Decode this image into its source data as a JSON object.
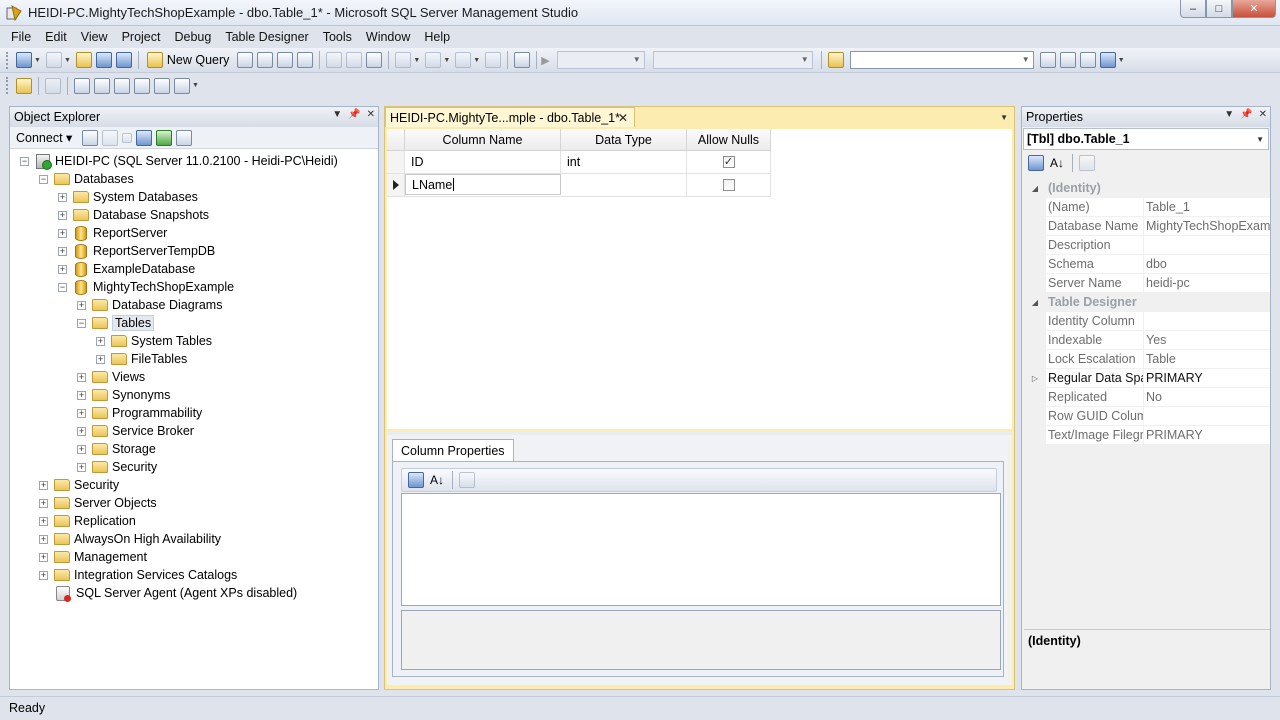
{
  "window": {
    "title": "HEIDI-PC.MightyTechShopExample - dbo.Table_1* - Microsoft SQL Server Management Studio",
    "minimize": "–",
    "maximize": "□",
    "close": "✕"
  },
  "menu": [
    "File",
    "Edit",
    "View",
    "Project",
    "Debug",
    "Table Designer",
    "Tools",
    "Window",
    "Help"
  ],
  "toolbar": {
    "new_query_label": "New Query"
  },
  "object_explorer": {
    "title": "Object Explorer",
    "connect_label": "Connect ▾",
    "tree": [
      {
        "label": "HEIDI-PC (SQL Server 11.0.2100 - Heidi-PC\\Heidi)",
        "icon": "server-icon",
        "level": 0,
        "exp": "−"
      },
      {
        "label": "Databases",
        "icon": "folder-icon",
        "level": 1,
        "exp": "−"
      },
      {
        "label": "System Databases",
        "icon": "folder-icon",
        "level": 2,
        "exp": "+"
      },
      {
        "label": "Database Snapshots",
        "icon": "folder-icon",
        "level": 2,
        "exp": "+"
      },
      {
        "label": "ReportServer",
        "icon": "database-icon",
        "level": 2,
        "exp": "+"
      },
      {
        "label": "ReportServerTempDB",
        "icon": "database-icon",
        "level": 2,
        "exp": "+"
      },
      {
        "label": "ExampleDatabase",
        "icon": "database-icon",
        "level": 2,
        "exp": "+"
      },
      {
        "label": "MightyTechShopExample",
        "icon": "database-icon",
        "level": 2,
        "exp": "−"
      },
      {
        "label": "Database Diagrams",
        "icon": "folder-icon",
        "level": 3,
        "exp": "+"
      },
      {
        "label": "Tables",
        "icon": "folder-icon",
        "level": 3,
        "exp": "−",
        "selected": true
      },
      {
        "label": "System Tables",
        "icon": "folder-icon",
        "level": 4,
        "exp": "+"
      },
      {
        "label": "FileTables",
        "icon": "folder-icon",
        "level": 4,
        "exp": "+"
      },
      {
        "label": "Views",
        "icon": "folder-icon",
        "level": 3,
        "exp": "+"
      },
      {
        "label": "Synonyms",
        "icon": "folder-icon",
        "level": 3,
        "exp": "+"
      },
      {
        "label": "Programmability",
        "icon": "folder-icon",
        "level": 3,
        "exp": "+"
      },
      {
        "label": "Service Broker",
        "icon": "folder-icon",
        "level": 3,
        "exp": "+"
      },
      {
        "label": "Storage",
        "icon": "folder-icon",
        "level": 3,
        "exp": "+"
      },
      {
        "label": "Security",
        "icon": "folder-icon",
        "level": 3,
        "exp": "+"
      },
      {
        "label": "Security",
        "icon": "folder-icon",
        "level": 1,
        "exp": "+"
      },
      {
        "label": "Server Objects",
        "icon": "folder-icon",
        "level": 1,
        "exp": "+"
      },
      {
        "label": "Replication",
        "icon": "folder-icon",
        "level": 1,
        "exp": "+"
      },
      {
        "label": "AlwaysOn High Availability",
        "icon": "folder-icon",
        "level": 1,
        "exp": "+"
      },
      {
        "label": "Management",
        "icon": "folder-icon",
        "level": 1,
        "exp": "+"
      },
      {
        "label": "Integration Services Catalogs",
        "icon": "folder-icon",
        "level": 1,
        "exp": "+"
      },
      {
        "label": "SQL Server Agent (Agent XPs disabled)",
        "icon": "agent-icon",
        "level": 1,
        "exp": ""
      }
    ]
  },
  "document": {
    "tab_label": "HEIDI-PC.MightyTe...mple - dbo.Table_1*",
    "tab_close": "✕",
    "grid": {
      "headers": {
        "name": "Column Name",
        "type": "Data Type",
        "nulls": "Allow Nulls"
      },
      "rows": [
        {
          "name": "ID",
          "type": "int",
          "allow_nulls": true
        },
        {
          "name": "LName",
          "type": "",
          "allow_nulls": false,
          "editing": true
        }
      ]
    },
    "column_properties_tab": "Column Properties"
  },
  "properties": {
    "title": "Properties",
    "object": "[Tbl] dbo.Table_1",
    "rows": [
      {
        "cat": true,
        "name": "(Identity)",
        "marker": "◢"
      },
      {
        "name": "(Name)",
        "value": "Table_1"
      },
      {
        "name": "Database Name",
        "value": "MightyTechShopExample"
      },
      {
        "name": "Description",
        "value": ""
      },
      {
        "name": "Schema",
        "value": "dbo"
      },
      {
        "name": "Server Name",
        "value": "heidi-pc"
      },
      {
        "cat": true,
        "name": "Table Designer",
        "marker": "◢"
      },
      {
        "name": "Identity Column",
        "value": ""
      },
      {
        "name": "Indexable",
        "value": "Yes"
      },
      {
        "name": "Lock Escalation",
        "value": "Table"
      },
      {
        "name": "Regular Data Spac",
        "value": "PRIMARY",
        "dark": true,
        "marker": "▷"
      },
      {
        "name": "Replicated",
        "value": "No"
      },
      {
        "name": "Row GUID Colum",
        "value": ""
      },
      {
        "name": "Text/Image Filegr",
        "value": "PRIMARY"
      }
    ],
    "help_title": "(Identity)"
  },
  "status": {
    "text": "Ready"
  }
}
